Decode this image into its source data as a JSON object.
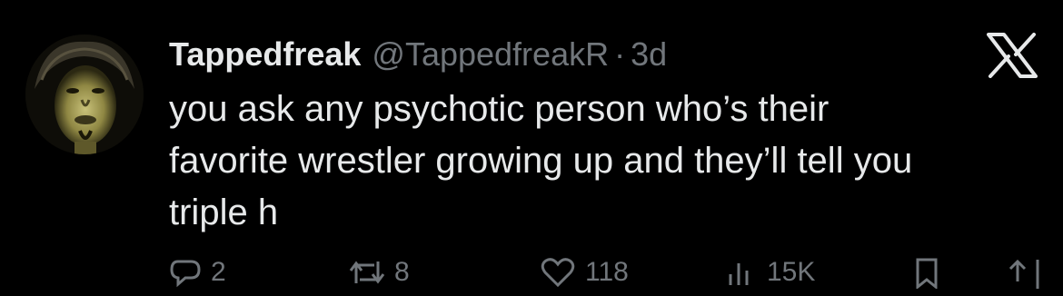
{
  "tweet": {
    "display_name": "Tappedfreak",
    "handle": "@TappedfreakR",
    "separator": "·",
    "time": "3d",
    "text": "you ask any psychotic person who’s their\nfavorite wrestler growing up and they’ll tell you\ntriple h"
  },
  "actions": {
    "replies": "2",
    "reposts": "8",
    "likes": "118",
    "views": "15K"
  },
  "icons": {
    "logo": "x-logo-icon",
    "reply": "reply-icon",
    "repost": "repost-icon",
    "like": "heart-icon",
    "views": "views-icon",
    "bookmark": "bookmark-icon",
    "share": "share-icon"
  },
  "colors": {
    "background": "#000000",
    "primary_text": "#e7e9ea",
    "secondary_text": "#71767b"
  }
}
